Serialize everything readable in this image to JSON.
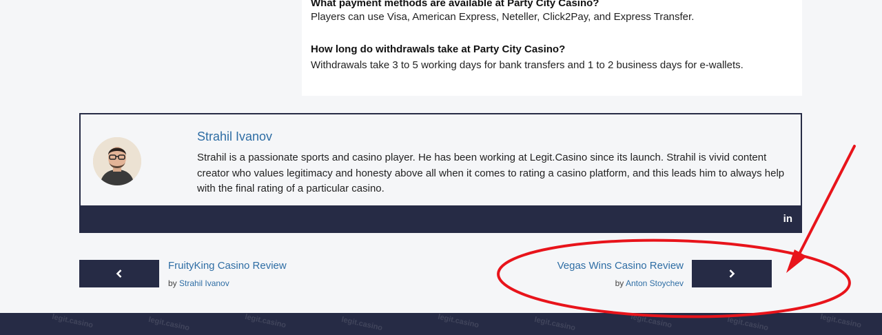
{
  "faq": [
    {
      "question": "What payment methods are available at Party City Casino?",
      "answer": "Players can use Visa, American Express, Neteller, Click2Pay, and Express Transfer."
    },
    {
      "question": "How long do withdrawals take at Party City Casino?",
      "answer": "Withdrawals take 3 to 5 working days for bank transfers and 1 to 2 business days for e-wallets."
    }
  ],
  "author": {
    "name": "Strahil Ivanov",
    "bio": "Strahil is a passionate sports and casino player. He has been working at Legit.Casino since its launch. Strahil is vivid content creator who values legitimacy and honesty above all when it comes to rating a casino platform, and this leads him to always help with the final rating of a particular casino.",
    "social_label": "in"
  },
  "prev_post": {
    "title": "FruityKing Casino Review",
    "by": "by",
    "author": "Strahil Ivanov"
  },
  "next_post": {
    "title": "Vegas Wins Casino Review",
    "by": "by",
    "author": "Anton Stoychev"
  },
  "footer": {
    "watermark": "legit.casino"
  },
  "colors": {
    "accent": "#2e6da4",
    "dark": "#262b45",
    "annotation": "#e8141b"
  }
}
